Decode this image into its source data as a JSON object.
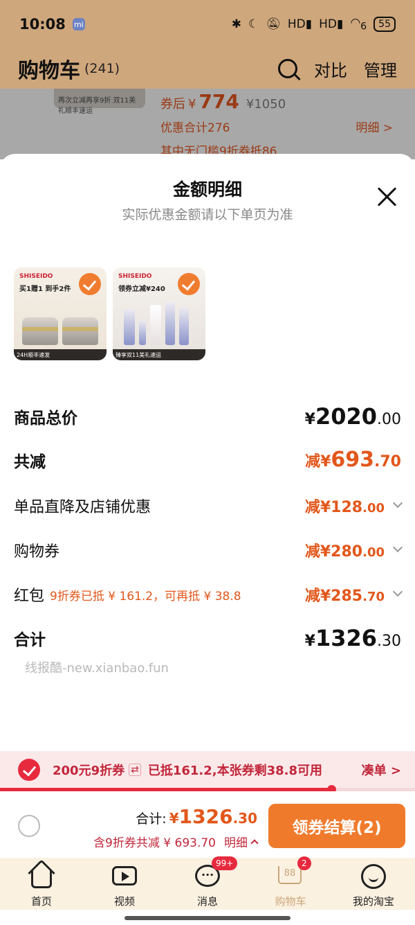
{
  "status_bar": {
    "time": "10:08",
    "mi_badge": "mi",
    "net1": "HD",
    "net2": "HD",
    "wifi_sub": "6",
    "battery": "55"
  },
  "header": {
    "title": "购物车",
    "count": "(241)",
    "compare": "对比",
    "manage": "管理",
    "icon": "search-icon"
  },
  "background_item": {
    "thumb_text": "再次立减再享9折  双11美礼顺丰速运",
    "price_prefix": "券后",
    "price_yen": "¥",
    "price_main": "774",
    "price_orig": "¥1050",
    "discount_total": "优惠合计276",
    "discount_detail": "其中无门槛9折券抵86",
    "detail_link": "明细 >"
  },
  "sheet": {
    "title": "金额明细",
    "subtitle": "实际优惠金额请以下单页为准",
    "products": [
      {
        "brand": "SHISEIDO",
        "promo": "买1赠1 到手2件",
        "footer": "24H顺丰速发"
      },
      {
        "brand": "SHISEIDO",
        "promo": "领券立减¥240",
        "footer": "臻享双11美礼速运"
      }
    ],
    "rows": {
      "total": {
        "label": "商品总价",
        "yen": "¥",
        "int": "2020",
        "dec": ".00"
      },
      "discount": {
        "label": "共减",
        "prefix": "减¥",
        "int": "693",
        "dec": ".70"
      },
      "store": {
        "label": "单品直降及店铺优惠",
        "prefix": "减¥",
        "int": "128",
        "dec": ".00"
      },
      "coupon": {
        "label": "购物券",
        "prefix": "减¥",
        "int": "280",
        "dec": ".00"
      },
      "redpacket": {
        "label": "红包",
        "note": "9折券已抵 ¥ 161.2，可再抵 ¥ 38.8",
        "prefix": "减¥",
        "int": "285",
        "dec": ".70"
      },
      "sum": {
        "label": "合计",
        "yen": "¥",
        "int": "1326",
        "dec": ".30"
      }
    },
    "watermark": "线报酷-new.xianbao.fun"
  },
  "coupon_bar": {
    "name": "200元9折券",
    "swap_icon": "⇄",
    "message": "已抵161.2,本张券剩38.8可用",
    "link": "凑单 >",
    "progress_fraction": 0.8
  },
  "checkout": {
    "total_label": "合计:",
    "total_yen": "¥",
    "total_int": "1326",
    "total_dec": ".30",
    "saving": "含9折券共减 ¥ 693.70",
    "detail": "明细",
    "button": "领券结算(2)"
  },
  "tabbar": {
    "tabs": [
      {
        "label": "首页",
        "icon": "home-icon"
      },
      {
        "label": "视频",
        "icon": "video-icon"
      },
      {
        "label": "消息",
        "icon": "message-icon",
        "badge": "99+"
      },
      {
        "label": "购物车",
        "icon": "cart-icon",
        "badge": "2",
        "cart_num": "88"
      },
      {
        "label": "我的淘宝",
        "icon": "profile-icon"
      }
    ]
  },
  "colors": {
    "accent": "#e2571b",
    "coupon_red": "#e72a3e",
    "button_orange": "#f07a2c",
    "header_bg": "#cfa77c"
  }
}
